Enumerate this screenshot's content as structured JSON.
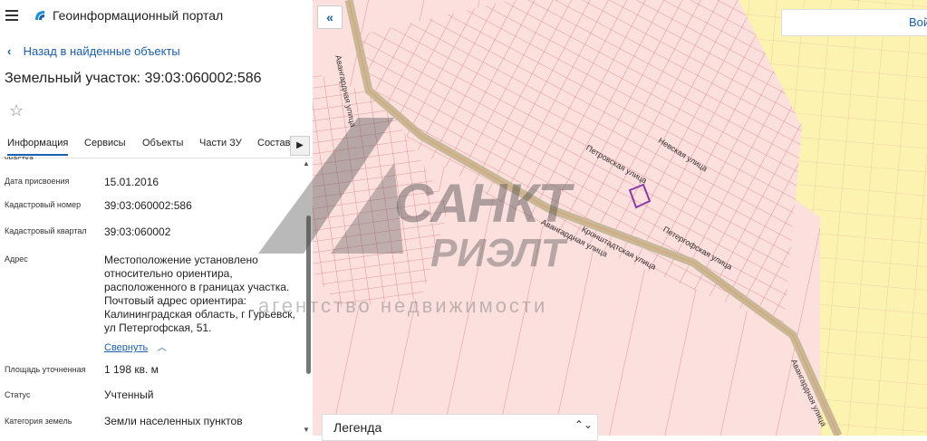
{
  "header": {
    "app_title": "Геоинформационный портал"
  },
  "back_link": "Назад в найденные объекты",
  "page_title": "Земельный участок: 39:03:060002:586",
  "tabs": [
    {
      "label": "Информация"
    },
    {
      "label": "Сервисы"
    },
    {
      "label": "Объекты"
    },
    {
      "label": "Части ЗУ"
    },
    {
      "label": "Состав"
    }
  ],
  "cut_label": "участка",
  "fields": [
    {
      "label": "Дата присвоения",
      "value": "15.01.2016"
    },
    {
      "label": "Кадастровый номер",
      "value": "39:03:060002:586"
    },
    {
      "label": "Кадастровый квартал",
      "value": "39:03:060002"
    },
    {
      "label": "Адрес",
      "value": "Местоположение установлено относительно ориентира, расположенного в границах участка. Почтовый адрес ориентира: Калининградская область, г Гурьевск, ул Петергофская, 51."
    },
    {
      "label": "Площадь уточненная",
      "value": "1 198 кв. м"
    },
    {
      "label": "Статус",
      "value": "Учтенный"
    },
    {
      "label": "Категория земель",
      "value": "Земли населенных пунктов"
    }
  ],
  "collapse_label": "Свернуть",
  "map": {
    "login_label": "Вой",
    "legend_label": "Легенда",
    "streets": {
      "avangardnaya_1": "Авангардная улица",
      "avangardnaya_2": "Авангардная улица",
      "avangardnaya_3": "Авангардная улица",
      "petrovskaya": "Петровская улица",
      "nevskaya": "Невская улица",
      "kronshtadtskaya": "Кронштадтская улица",
      "petergofskaya": "Петергофская улица"
    },
    "colors": {
      "parcel_fill": "#fbe0de",
      "parcel_line": "#e07070",
      "zone_yellow": "#fdf3b0",
      "road": "#c8b89a",
      "selected": "#8a3aa8"
    }
  },
  "watermark": {
    "line1": "САНКТ",
    "line2": "РИЭЛТ",
    "line3": "агентство недвижимости"
  }
}
